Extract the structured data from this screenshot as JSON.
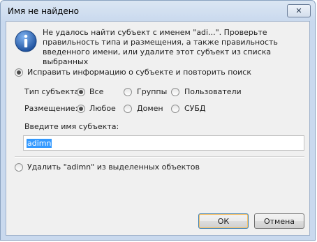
{
  "dialog": {
    "title": "Имя не найдено",
    "message": "Не удалось найти субъект с именем \"adi...\". Проверьте правильность типа и размещения, а также правильность введенного имени, или удалите этот субъект из списка выбранных",
    "fix_option": "Исправить информацию о субъекте и повторить поиск",
    "remove_option": "Удалить \"adimn\" из выделенных объектов",
    "type_label": "Тип субъекта:",
    "type_options": [
      "Все",
      "Группы",
      "Пользователи"
    ],
    "type_selected": "Все",
    "location_label": "Размещение:",
    "location_options": [
      "Любое",
      "Домен",
      "СУБД"
    ],
    "location_selected": "Любое",
    "name_label": "Введите имя субъекта:",
    "name_value": "adimn",
    "ok_label": "ОК",
    "cancel_label": "Отмена",
    "close_symbol": "✕"
  },
  "colors": {
    "info_icon": "#2b63b5",
    "selection": "#3399ff",
    "close_x": "#2c3e55"
  },
  "icons": {
    "info": "info-icon",
    "close": "close-icon"
  }
}
